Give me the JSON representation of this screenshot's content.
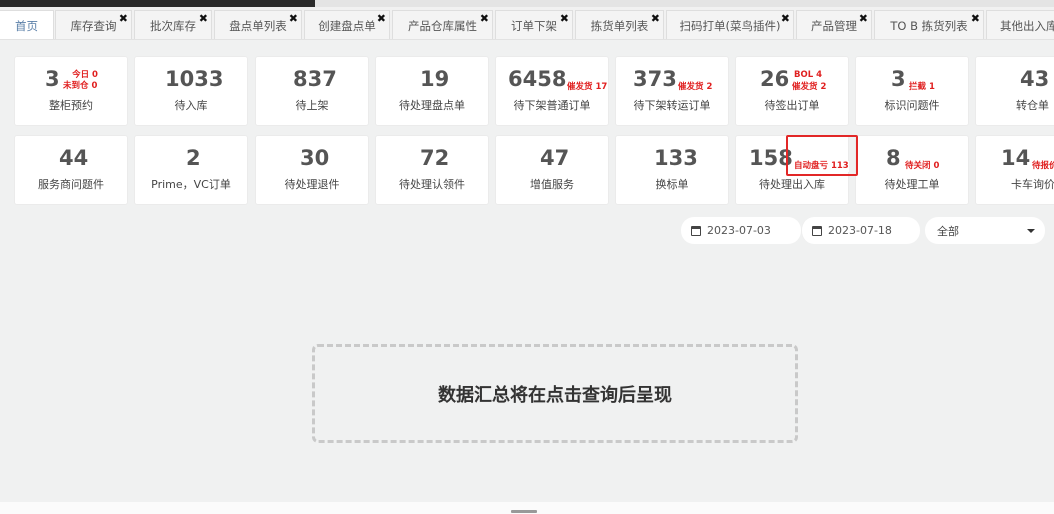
{
  "tabs": [
    {
      "label": "首页",
      "closable": false
    },
    {
      "label": "库存查询",
      "closable": true
    },
    {
      "label": "批次库存",
      "closable": true
    },
    {
      "label": "盘点单列表",
      "closable": true
    },
    {
      "label": "创建盘点单",
      "closable": true
    },
    {
      "label": "产品仓库属性",
      "closable": true
    },
    {
      "label": "订单下架",
      "closable": true
    },
    {
      "label": "拣货单列表",
      "closable": true
    },
    {
      "label": "扫码打单(菜鸟插件)",
      "closable": true
    },
    {
      "label": "产品管理",
      "closable": true
    },
    {
      "label": "TO B 拣货列表",
      "closable": true
    },
    {
      "label": "其他出入库",
      "closable": false
    }
  ],
  "close_glyph": "✖",
  "cards": [
    {
      "value": "3",
      "label": "整柜预约",
      "subs": [
        "今日 0",
        "未到仓 0"
      ]
    },
    {
      "value": "1033",
      "label": "待入库",
      "subs": []
    },
    {
      "value": "837",
      "label": "待上架",
      "subs": []
    },
    {
      "value": "19",
      "label": "待处理盘点单",
      "subs": []
    },
    {
      "value": "6458",
      "label": "待下架普通订单",
      "subs": [
        "催发货 17"
      ]
    },
    {
      "value": "373",
      "label": "待下架转运订单",
      "subs": [
        "催发货 2"
      ]
    },
    {
      "value": "26",
      "label": "待签出订单",
      "subs": [
        "BOL 4",
        "催发货 2"
      ]
    },
    {
      "value": "3",
      "label": "标识问题件",
      "subs": [
        "拦截 1"
      ]
    },
    {
      "value": "43",
      "label": "转仓单",
      "subs": []
    },
    {
      "value": "44",
      "label": "服务商问题件",
      "subs": []
    },
    {
      "value": "2",
      "label": "Prime，VC订单",
      "subs": []
    },
    {
      "value": "30",
      "label": "待处理退件",
      "subs": []
    },
    {
      "value": "72",
      "label": "待处理认领件",
      "subs": []
    },
    {
      "value": "47",
      "label": "增值服务",
      "subs": []
    },
    {
      "value": "133",
      "label": "换标单",
      "subs": []
    },
    {
      "value": "158",
      "label": "待处理出入库",
      "subs": [
        "自动盘亏 113"
      ]
    },
    {
      "value": "8",
      "label": "待处理工单",
      "subs": [
        "待关闭 0"
      ]
    },
    {
      "value": "14",
      "label": "卡车询价",
      "subs": [
        "待报价"
      ]
    }
  ],
  "filters": {
    "start_date": "2023-07-03",
    "end_date": "2023-07-18",
    "scope": "全部"
  },
  "placeholder_text": "数据汇总将在点击查询后呈现"
}
